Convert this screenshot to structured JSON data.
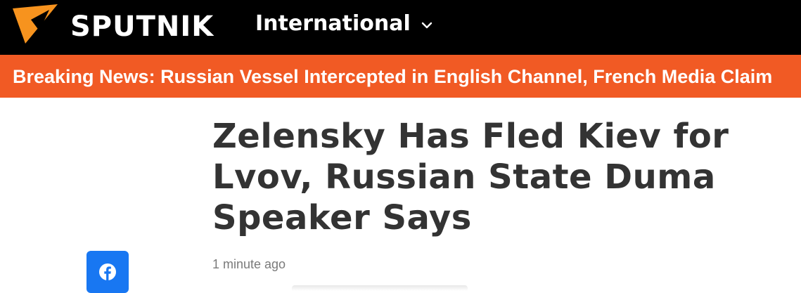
{
  "header": {
    "logo_text": "SPUTNIK",
    "edition_label": "International",
    "logo_icon": "sputnik-triangle-icon",
    "edition_icon": "chevron-down-icon",
    "background_color": "#000000",
    "logo_accent_color": "#f7931e"
  },
  "breaking": {
    "text": "Breaking News: Russian Vessel Intercepted in English Channel, French Media Claim",
    "background_color": "#f15a24"
  },
  "article": {
    "title": "Zelensky Has Fled Kiev for Lvov, Russian State Duma Speaker Says",
    "timestamp": "1 minute ago"
  },
  "share": {
    "facebook_icon": "facebook-icon",
    "facebook_color": "#1877f2"
  }
}
